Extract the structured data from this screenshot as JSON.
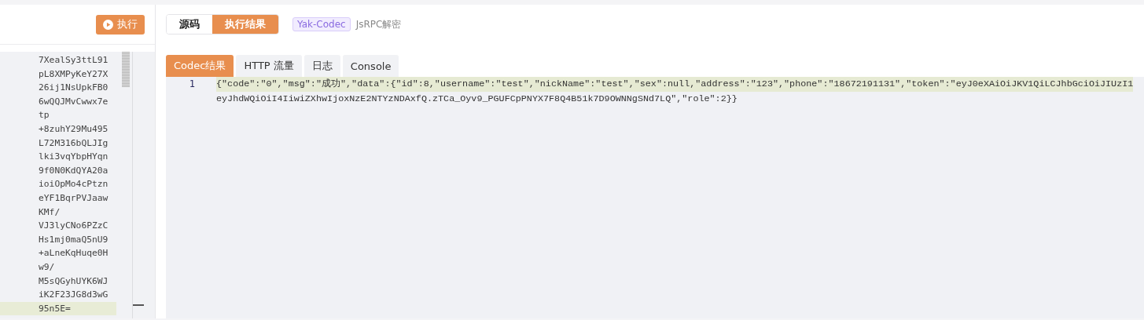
{
  "run_button": {
    "label": "执行"
  },
  "source_lines": [
    {
      "text": "7XealSy3ttL91",
      "current": false
    },
    {
      "text": "pL8XMPyKeY27X",
      "current": false
    },
    {
      "text": "26ij1NsUpkFB0",
      "current": false
    },
    {
      "text": "6wQQJMvCwwx7e",
      "current": false
    },
    {
      "text": "tp",
      "current": false
    },
    {
      "text": "+8zuhY29Mu495",
      "current": false
    },
    {
      "text": "L72M316bQLJIg",
      "current": false
    },
    {
      "text": "lki3vqYbpHYqn",
      "current": false
    },
    {
      "text": "9f0N0KdQYA20a",
      "current": false
    },
    {
      "text": "ioiOpMo4cPtzn",
      "current": false
    },
    {
      "text": "eYF1BqrPVJaaw",
      "current": false
    },
    {
      "text": "KMf/",
      "current": false
    },
    {
      "text": "VJ3lyCNo6PZzC",
      "current": false
    },
    {
      "text": "Hs1mj0maQ5nU9",
      "current": false
    },
    {
      "text": "+aLneKqHuqe0H",
      "current": false
    },
    {
      "text": "w9/",
      "current": false
    },
    {
      "text": "M5sQGyhUYK6WJ",
      "current": false
    },
    {
      "text": "iK2F23JG8d3wG",
      "current": false
    },
    {
      "text": "95n5E=",
      "current": true
    }
  ],
  "view_toggle": [
    {
      "label": "源码",
      "selected": false
    },
    {
      "label": "执行结果",
      "selected": true
    }
  ],
  "tag": "Yak-Codec",
  "subtitle": "JsRPC解密",
  "result_tabs": [
    {
      "label": "Codec结果",
      "selected": true
    },
    {
      "label": "HTTP 流量",
      "selected": false
    },
    {
      "label": "日志",
      "selected": false
    },
    {
      "label": "Console",
      "selected": false
    }
  ],
  "result_lines": [
    {
      "number": "1",
      "current": true,
      "segments": [
        "{\"code\":\"0\",\"msg\":\"成功\",\"data\":{\"id\":8,\"username\":\"test\",\"nickName\":\"test\",\"sex\":null,\"address\":\"123\",\"phone\":\"18672191131\",\"token\":\"eyJ0eXAiOiJKV1QiLCJhbGciOiJIUzI1",
        "eyJhdWQiOiI4IiwiZXhwIjoxNzE2NTYzNDAxfQ.zTCa_Oyv9_PGUFCpPNYX7F8Q4B51k7D9OWNNgSNd7LQ\",\"role\":2}}"
      ]
    }
  ]
}
